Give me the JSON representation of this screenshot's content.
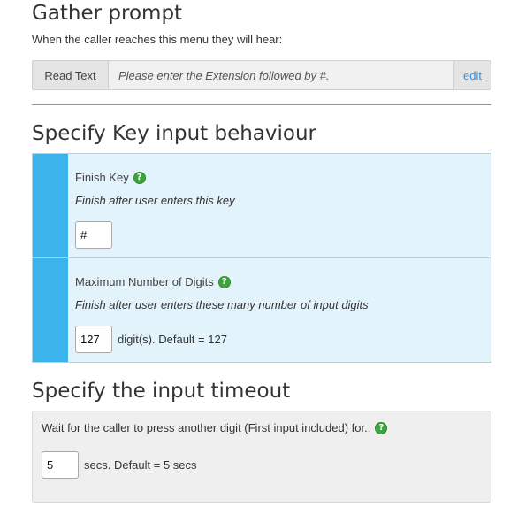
{
  "gather": {
    "title": "Gather prompt",
    "description": "When the caller reaches this menu they will hear:",
    "read_label": "Read Text",
    "read_text": "Please enter the Extension followed by #.",
    "edit_label": "edit"
  },
  "key_input": {
    "title": "Specify Key input behaviour",
    "finish_key": {
      "label": "Finish Key",
      "hint": "Finish after user enters this key",
      "value": "#"
    },
    "max_digits": {
      "label": "Maximum Number of Digits",
      "hint": "Finish after user enters these many number of input digits",
      "value": "127",
      "suffix": "digit(s). Default = 127"
    }
  },
  "timeout": {
    "title": "Specify the input timeout",
    "description": "Wait for the caller to press another digit (First input included) for..",
    "value": "5",
    "suffix": "secs. Default = 5 secs"
  },
  "icons": {
    "help": "help-icon"
  },
  "colors": {
    "accent_stripe": "#3cb3ea",
    "panel_bg": "#e3f3fb",
    "help_green": "#3fa43f",
    "link": "#3a8fd9"
  }
}
